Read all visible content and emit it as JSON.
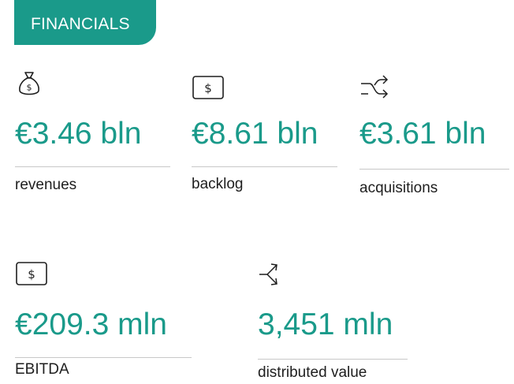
{
  "header": {
    "title": "FINANCIALS"
  },
  "colors": {
    "accent": "#1a9a8a",
    "text": "#1e1e1e",
    "rule": "#c8c8c8"
  },
  "metrics": [
    {
      "icon": "money-bag-icon",
      "value": "€3.46 bln",
      "label": "revenues"
    },
    {
      "icon": "dollar-box-icon",
      "value": "€8.61 bln",
      "label": "backlog"
    },
    {
      "icon": "shuffle-arrows-icon",
      "value": "€3.61 bln",
      "label": "acquisitions"
    },
    {
      "icon": "dollar-box-icon",
      "value": "€209.3 mln",
      "label": "EBITDA"
    },
    {
      "icon": "split-arrows-icon",
      "value": "3,451 mln",
      "label": "distributed value"
    }
  ]
}
